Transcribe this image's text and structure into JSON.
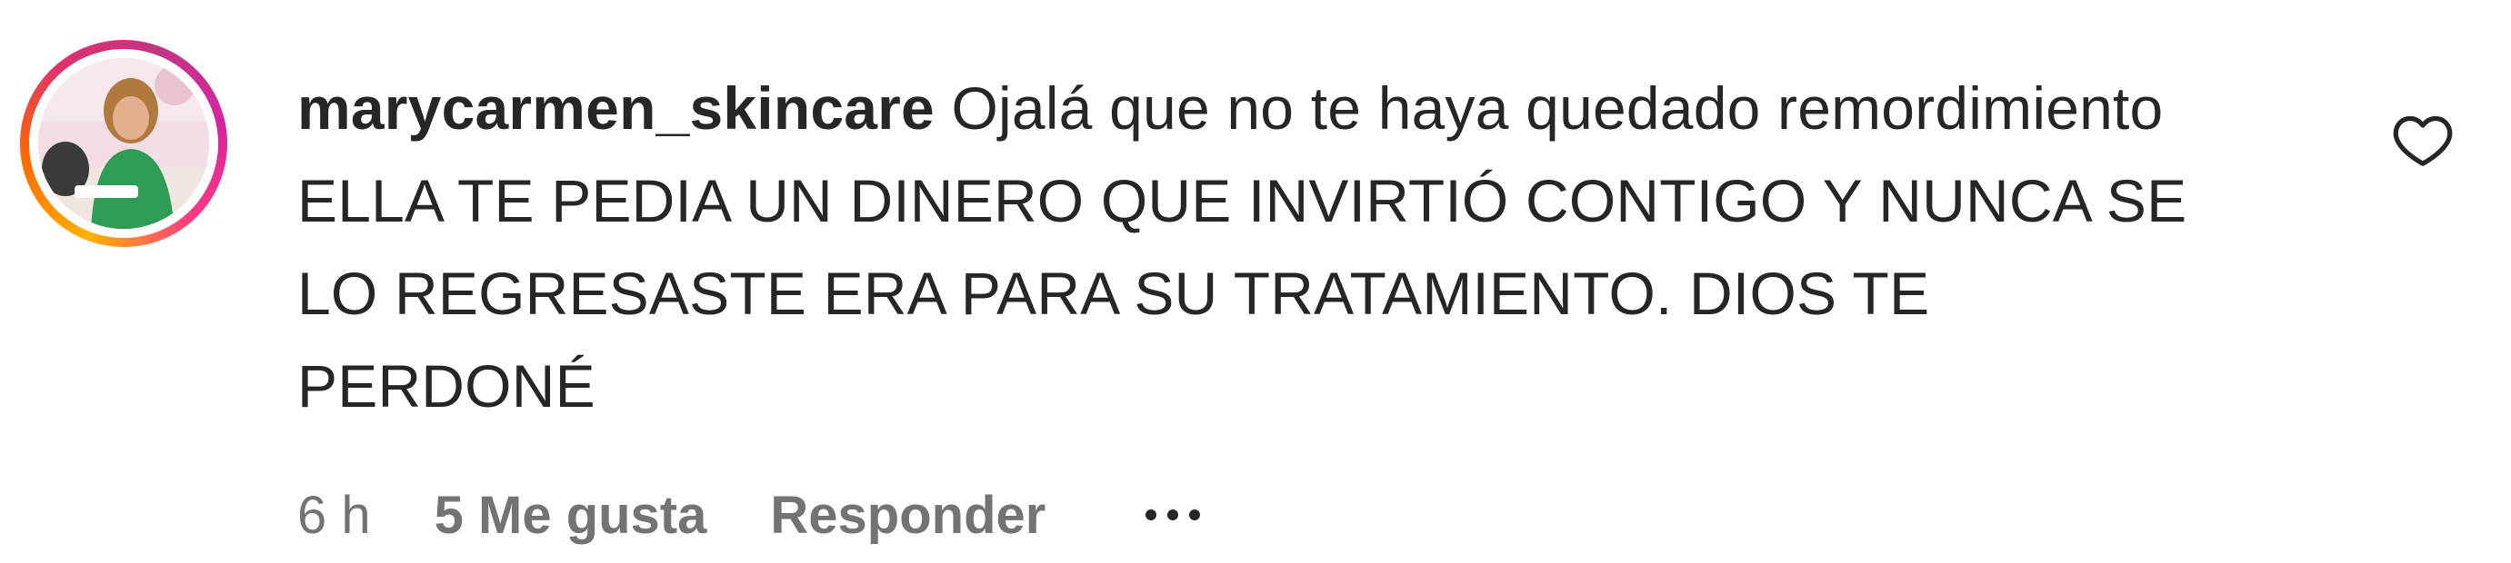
{
  "comment": {
    "username": "marycarmen_skincare",
    "text": "Ojalá que no te haya quedado remordimiento ELLA TE PEDIA UN DINERO QUE INVIRTIÓ CONTIGO Y NUNCA SE LO REGRESASTE ERA PARA SU TRATAMIENTO. DIOS TE PERDONÉ",
    "time": "6 h",
    "likes": "5 Me gusta",
    "reply_label": "Responder"
  },
  "icons": {
    "like": "heart-outline-icon",
    "more": "more-horizontal-icon"
  },
  "colors": {
    "text": "#262626",
    "meta": "#737373",
    "story_ring_start": "#ffb300",
    "story_ring_end": "#d6249f"
  }
}
